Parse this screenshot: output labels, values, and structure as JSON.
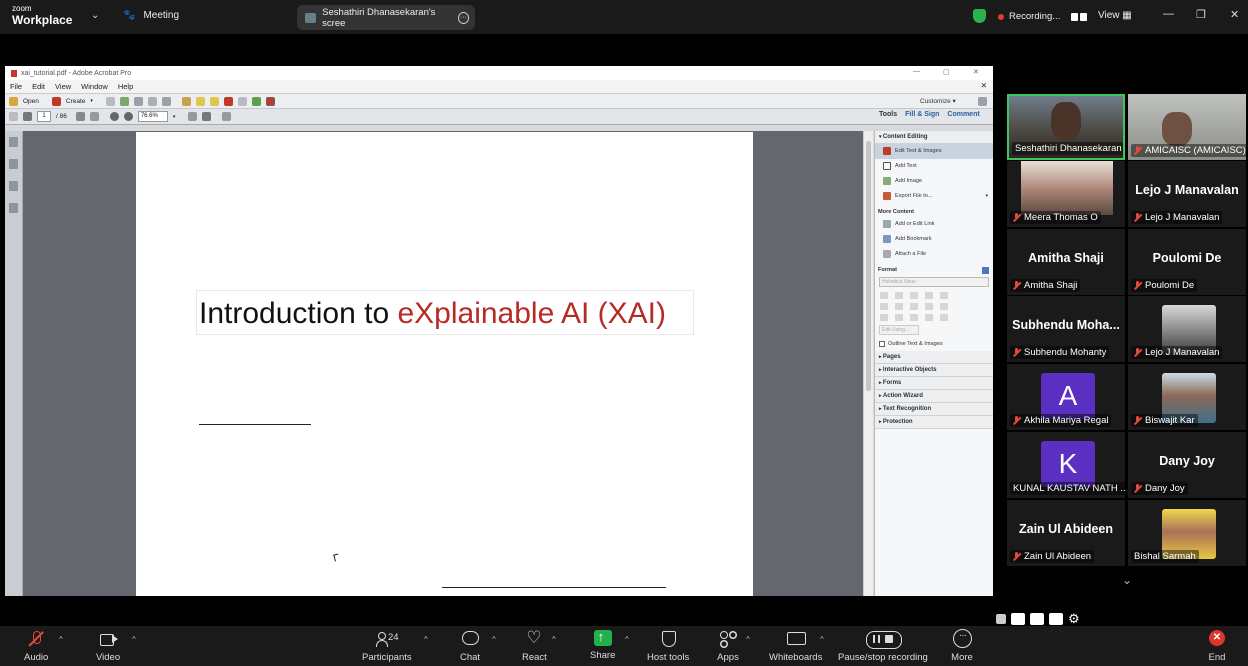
{
  "topbar": {
    "logo_line1": "zoom",
    "logo_line2": "Workplace",
    "meeting_label": "Meeting",
    "share_pill_label": "Seshathiri Dhanasekaran's scree",
    "recording_label": "Recording...",
    "view_label": "View"
  },
  "acrobat": {
    "title": "xai_tutorial.pdf - Adobe Acrobat Pro",
    "menu": [
      "File",
      "Edit",
      "View",
      "Window",
      "Help"
    ],
    "toolbar": {
      "open": "Open",
      "create": "Create",
      "customize": "Customize"
    },
    "nav": {
      "page": "1",
      "page_total": "/ 86",
      "zoom": "76.6%"
    },
    "tabs": [
      "Tools",
      "Fill & Sign",
      "Comment"
    ],
    "slide": {
      "title_black": "Introduction to ",
      "title_red": "eXplainable AI (XAI)"
    },
    "tools_panel": {
      "content_editing": "Content Editing",
      "content_items": [
        "Edit Text & Images",
        "Add Text",
        "Add Image",
        "Export File to..."
      ],
      "more_content": "More Content",
      "more_items": [
        "Add or Edit Link",
        "Add Bookmark",
        "Attach a File"
      ],
      "format": "Format",
      "font_placeholder": "Helvetica Neue",
      "edit_using": "Edit Using...",
      "outline_checkbox": "Outline Text & Images",
      "sections": [
        "Pages",
        "Interactive Objects",
        "Forms",
        "Action Wizard",
        "Text Recognition",
        "Protection"
      ]
    }
  },
  "participants": [
    {
      "name": "Seshathiri Dhanasekaran",
      "type": "video",
      "active": true
    },
    {
      "name": "AMICAISC (AMICAISC)",
      "type": "video"
    },
    {
      "name": "Meera Thomas O",
      "type": "video"
    },
    {
      "name": "Lejo J Manavalan",
      "big": "Lejo J Manavalan",
      "type": "name"
    },
    {
      "name": "Amitha Shaji",
      "big": "Amitha Shaji",
      "type": "name"
    },
    {
      "name": "Poulomi De",
      "big": "Poulomi De",
      "type": "name"
    },
    {
      "name": "Subhendu Mohanty",
      "big": "Subhendu Moha...",
      "type": "name"
    },
    {
      "name": "Lejo J Manavalan",
      "type": "photo"
    },
    {
      "name": "Akhila Mariya Regal",
      "initial": "A",
      "type": "avatar"
    },
    {
      "name": "Biswajit Kar",
      "type": "photo"
    },
    {
      "name": "KUNAL KAUSTAV NATH ...",
      "initial": "K",
      "type": "avatar"
    },
    {
      "name": "Dany Joy",
      "big": "Dany Joy",
      "type": "name"
    },
    {
      "name": "Zain Ul Abideen",
      "big": "Zain Ul Abideen",
      "type": "name"
    },
    {
      "name": "Bishal Sarmah",
      "type": "photo"
    }
  ],
  "bottombar": {
    "audio": "Audio",
    "video": "Video",
    "participants": "Participants",
    "participant_count": "24",
    "chat": "Chat",
    "react": "React",
    "share": "Share",
    "host_tools": "Host tools",
    "apps": "Apps",
    "whiteboards": "Whiteboards",
    "recording": "Pause/stop recording",
    "more": "More",
    "end": "End"
  },
  "colors": {
    "accent_green": "#22b24c",
    "end_red": "#e0352b",
    "title_red": "#b72b26",
    "avatar_purple": "#5a2fc2"
  }
}
